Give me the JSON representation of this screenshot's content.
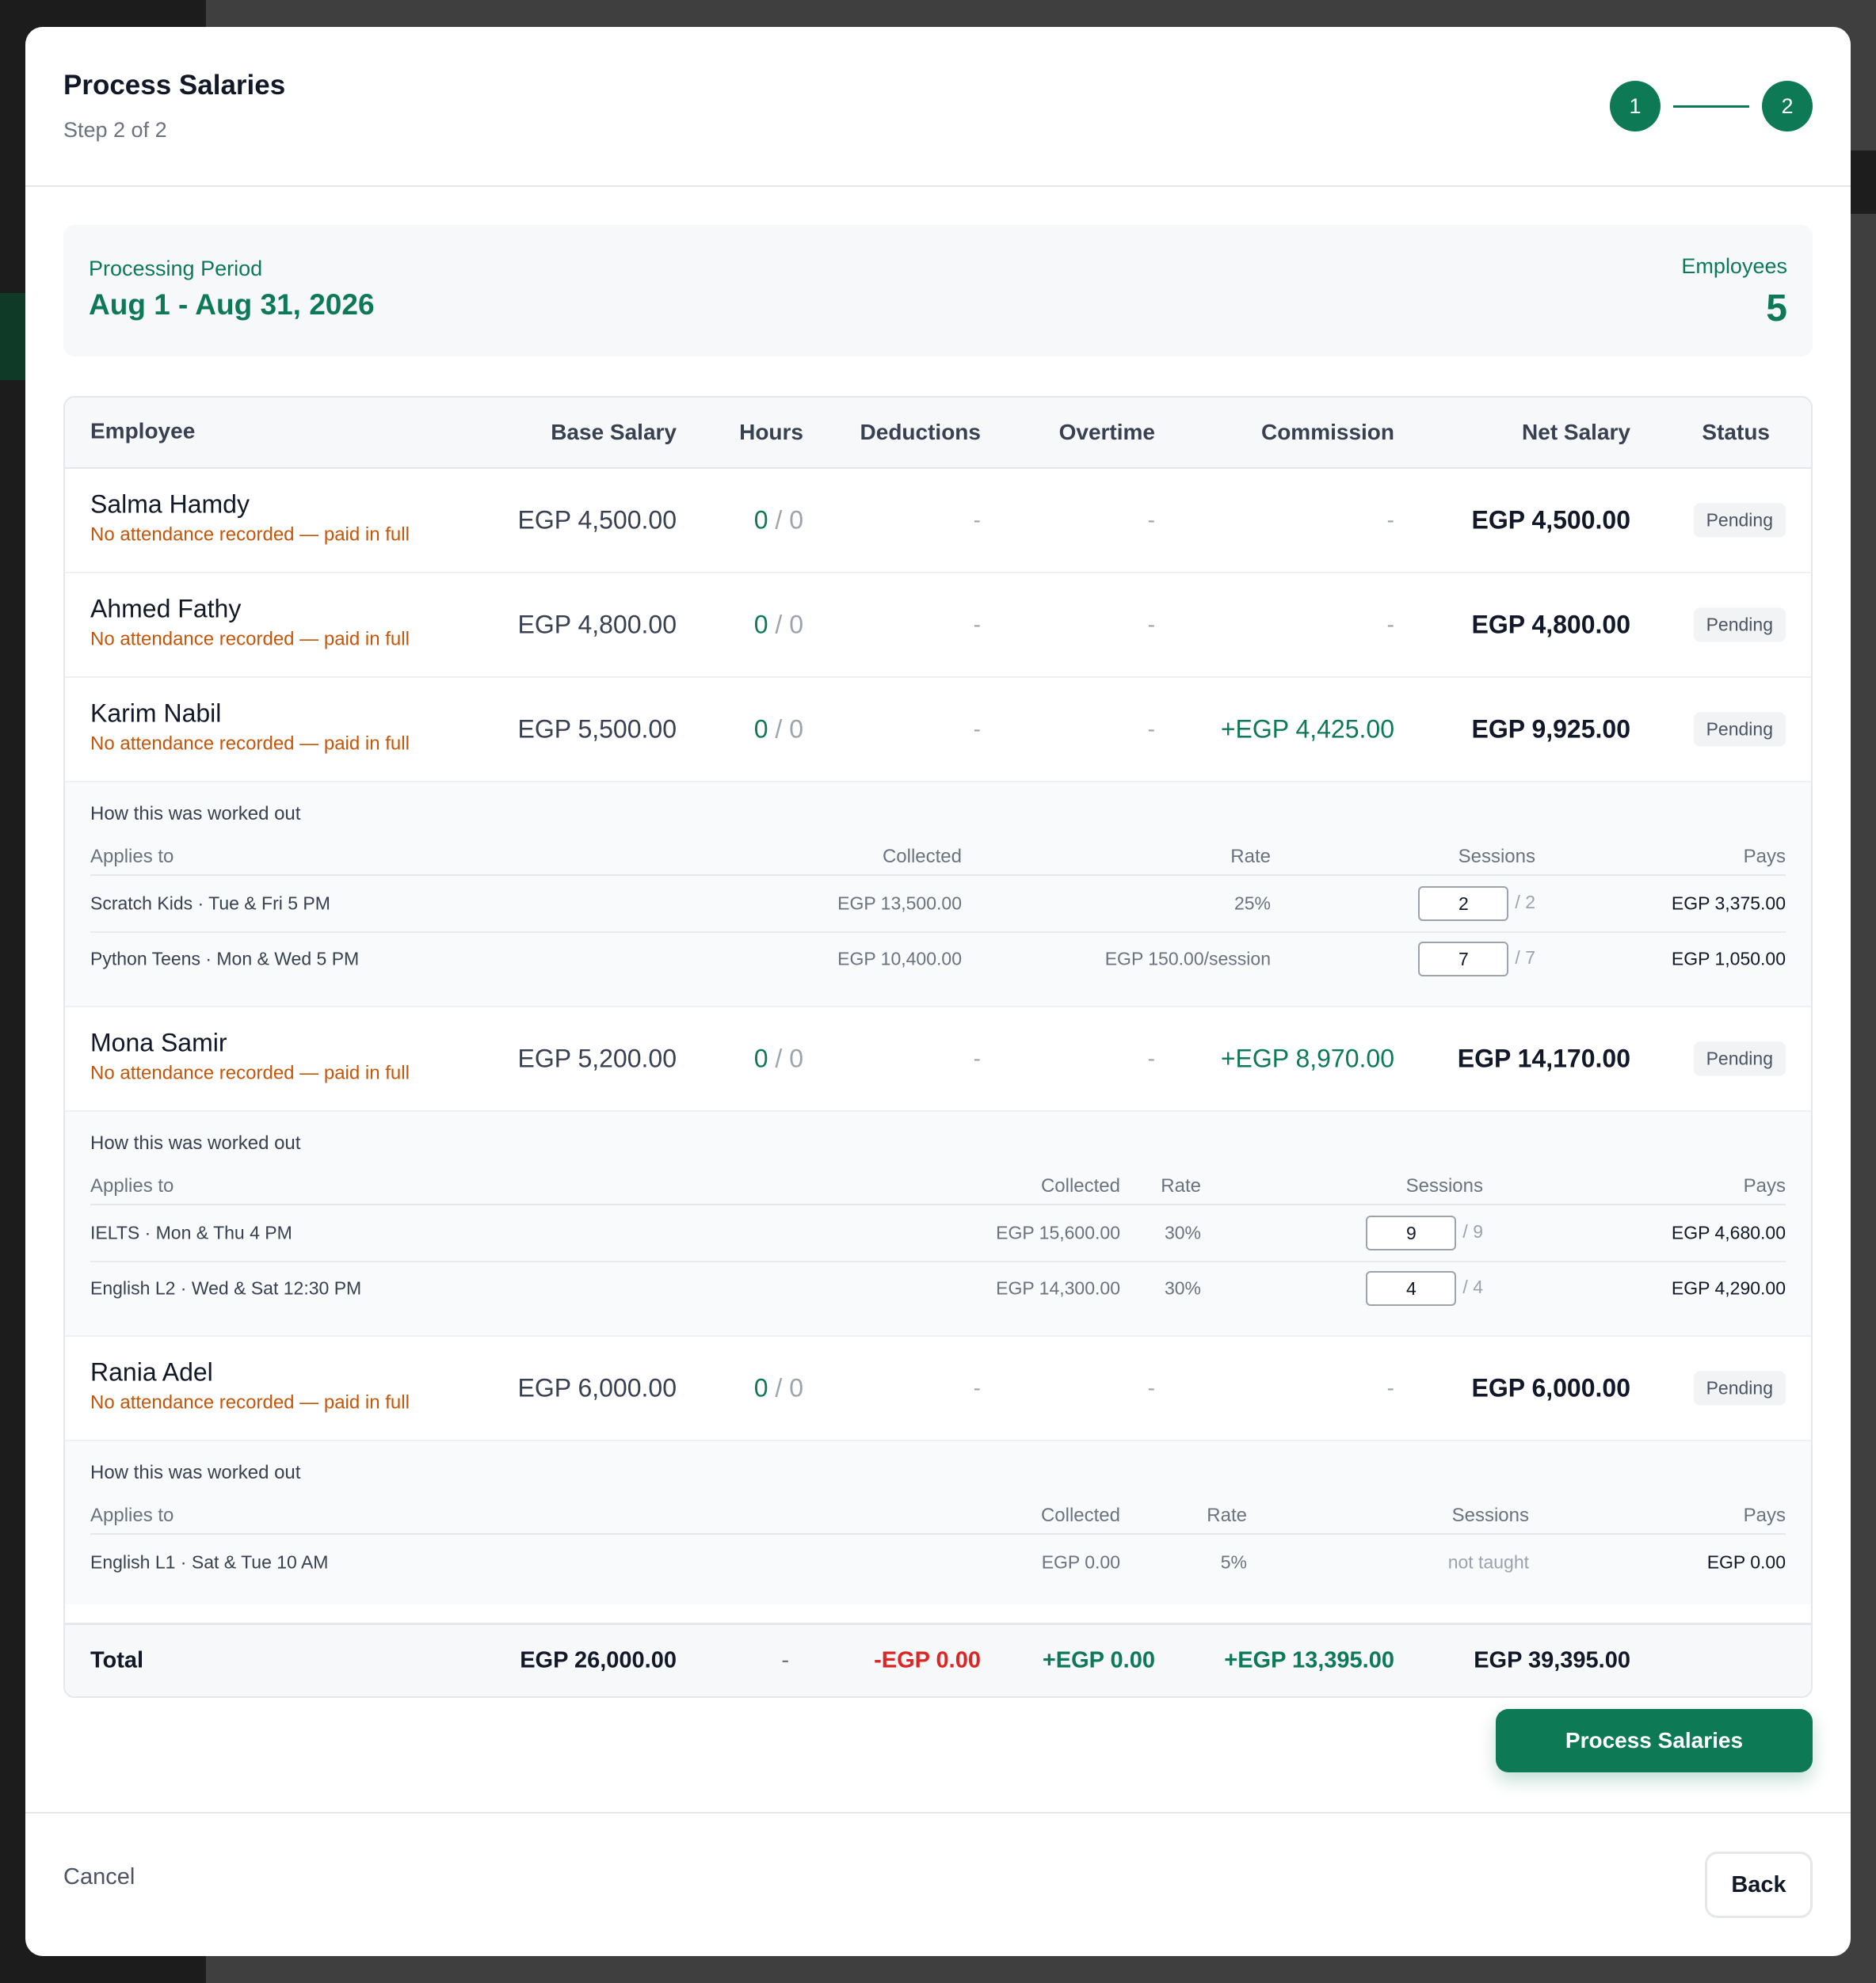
{
  "modal": {
    "title": "Process Salaries",
    "subtitle": "Step 2 of 2",
    "steps": [
      "1",
      "2"
    ]
  },
  "period": {
    "label": "Processing Period",
    "value": "Aug 1 - Aug 31, 2026",
    "employees_label": "Employees",
    "employees_count": "5"
  },
  "table": {
    "headers": {
      "employee": "Employee",
      "base": "Base Salary",
      "hours": "Hours",
      "deductions": "Deductions",
      "overtime": "Overtime",
      "commission": "Commission",
      "net": "Net Salary",
      "status": "Status"
    },
    "rows": [
      {
        "name": "Salma Hamdy",
        "note": "No attendance recorded — paid in full",
        "base": "EGP 4,500.00",
        "hours_worked": "0",
        "hours_sep": "/",
        "hours_total": "0",
        "deductions": "-",
        "overtime": "-",
        "commission": "-",
        "net": "EGP 4,500.00",
        "status": "Pending"
      },
      {
        "name": "Ahmed Fathy",
        "note": "No attendance recorded — paid in full",
        "base": "EGP 4,800.00",
        "hours_worked": "0",
        "hours_sep": "/",
        "hours_total": "0",
        "deductions": "-",
        "overtime": "-",
        "commission": "-",
        "net": "EGP 4,800.00",
        "status": "Pending"
      },
      {
        "name": "Karim Nabil",
        "note": "No attendance recorded — paid in full",
        "base": "EGP 5,500.00",
        "hours_worked": "0",
        "hours_sep": "/",
        "hours_total": "0",
        "deductions": "-",
        "overtime": "-",
        "commission": "+EGP 4,425.00",
        "net": "EGP 9,925.00",
        "status": "Pending"
      },
      {
        "name": "Mona Samir",
        "note": "No attendance recorded — paid in full",
        "base": "EGP 5,200.00",
        "hours_worked": "0",
        "hours_sep": "/",
        "hours_total": "0",
        "deductions": "-",
        "overtime": "-",
        "commission": "+EGP 8,970.00",
        "net": "EGP 14,170.00",
        "status": "Pending"
      },
      {
        "name": "Rania Adel",
        "note": "No attendance recorded — paid in full",
        "base": "EGP 6,000.00",
        "hours_worked": "0",
        "hours_sep": "/",
        "hours_total": "0",
        "deductions": "-",
        "overtime": "-",
        "commission": "-",
        "net": "EGP 6,000.00",
        "status": "Pending"
      }
    ],
    "breakdowns": {
      "karim": {
        "title": "How this was worked out",
        "headers": {
          "applies": "Applies to",
          "collected": "Collected",
          "rate": "Rate",
          "sessions": "Sessions",
          "pays": "Pays"
        },
        "lines": [
          {
            "applies": "Scratch Kids · Tue & Fri 5 PM",
            "collected": "EGP 13,500.00",
            "rate": "25%",
            "sessions": "2",
            "sessions_total": "/ 2",
            "pays": "EGP 3,375.00"
          },
          {
            "applies": "Python Teens · Mon & Wed 5 PM",
            "collected": "EGP 10,400.00",
            "rate": "EGP 150.00/session",
            "sessions": "7",
            "sessions_total": "/ 7",
            "pays": "EGP 1,050.00"
          }
        ]
      },
      "mona": {
        "title": "How this was worked out",
        "headers": {
          "applies": "Applies to",
          "collected": "Collected",
          "rate": "Rate",
          "sessions": "Sessions",
          "pays": "Pays"
        },
        "lines": [
          {
            "applies": "IELTS · Mon & Thu 4 PM",
            "collected": "EGP 15,600.00",
            "rate": "30%",
            "sessions": "9",
            "sessions_total": "/ 9",
            "pays": "EGP 4,680.00"
          },
          {
            "applies": "English L2 · Wed & Sat 12:30 PM",
            "collected": "EGP 14,300.00",
            "rate": "30%",
            "sessions": "4",
            "sessions_total": "/ 4",
            "pays": "EGP 4,290.00"
          }
        ]
      },
      "rania": {
        "title": "How this was worked out",
        "headers": {
          "applies": "Applies to",
          "collected": "Collected",
          "rate": "Rate",
          "sessions": "Sessions",
          "pays": "Pays"
        },
        "lines": [
          {
            "applies": "English L1 · Sat & Tue 10 AM",
            "collected": "EGP 0.00",
            "rate": "5%",
            "sessions": "not taught",
            "pays": "EGP 0.00"
          }
        ]
      }
    },
    "total": {
      "label": "Total",
      "base": "EGP 26,000.00",
      "hours": "-",
      "deductions": "-EGP 0.00",
      "overtime": "+EGP 0.00",
      "commission": "+EGP 13,395.00",
      "net": "EGP 39,395.00"
    }
  },
  "actions": {
    "process": "Process Salaries",
    "cancel": "Cancel",
    "back": "Back"
  },
  "colors": {
    "accent": "#0e7a55",
    "warning_text": "#c2570c",
    "negative": "#dc2626",
    "badge_bg": "#f1f3f5"
  }
}
